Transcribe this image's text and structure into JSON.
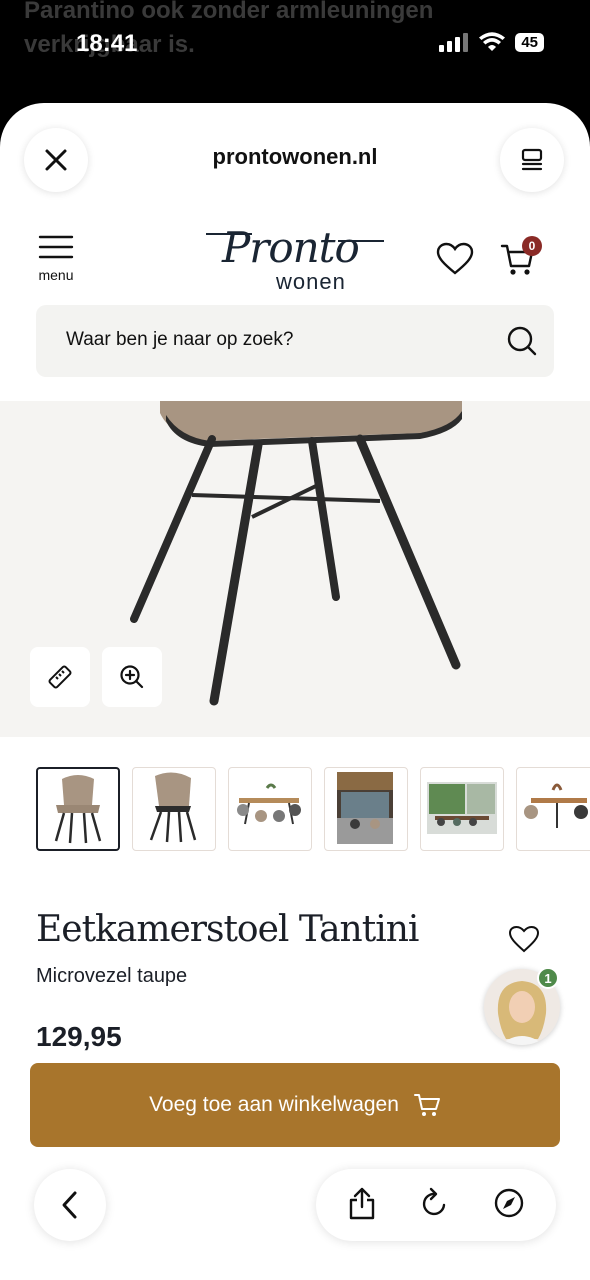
{
  "background": {
    "text": "Parantino ook zonder armleuningen verkrijgbaar is."
  },
  "status_bar": {
    "time": "18:41",
    "battery": "45"
  },
  "browser": {
    "domain": "prontowonen.nl",
    "close_icon": "close-icon",
    "tabs_icon": "tabs-icon"
  },
  "site": {
    "logo_main": "Pronto",
    "logo_sub": "wonen",
    "menu_label": "menu",
    "cart_count": "0",
    "search_placeholder": "Waar ben je naar op zoek?"
  },
  "product": {
    "title": "Eetkamerstoel Tantini",
    "variant": "Microvezel taupe",
    "price": "129,95",
    "add_to_cart": "Voeg toe aan winkelwagen",
    "thumbnails": 6
  },
  "chat": {
    "badge": "1"
  },
  "colors": {
    "accent": "#a8752c",
    "badge_red": "#8a2a26",
    "badge_green": "#4f8a4a",
    "text": "#1b1f27"
  }
}
